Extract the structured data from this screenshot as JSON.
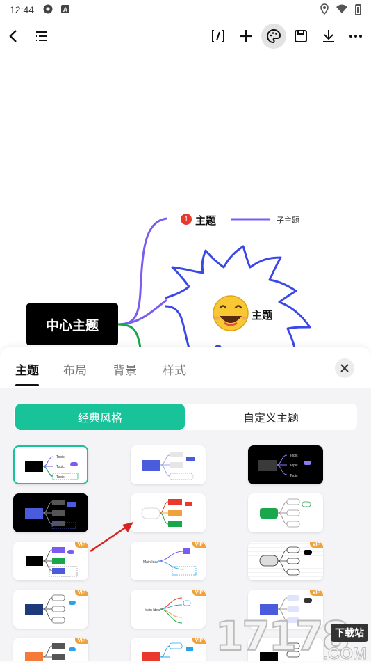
{
  "status_bar": {
    "time": "12:44",
    "icons": [
      "settings-icon",
      "app-a-icon",
      "location-icon",
      "wifi-icon",
      "battery-icon"
    ]
  },
  "toolbar": {
    "back": "back-arrow-icon",
    "outline": "outline-list-icon",
    "items": [
      "format-brush-icon",
      "add-icon",
      "palette-icon",
      "save-icon",
      "download-icon",
      "more-icon"
    ],
    "active_item": "palette-icon"
  },
  "mindmap": {
    "center": "中心主题",
    "topic1": "主题",
    "topic1_badge": "1",
    "subtopic": "子主题",
    "topic2": "主题"
  },
  "sheet": {
    "tabs": [
      "主题",
      "布局",
      "背景",
      "样式"
    ],
    "active_tab": "主题",
    "segments": {
      "classic": "经典风格",
      "custom": "自定义主题"
    },
    "thumb_text": {
      "topic": "Topic",
      "main_idea": "Main Idea"
    },
    "vip": "VIP"
  },
  "watermark": {
    "digits": "17178",
    "tag": "下载站",
    "domain": ".COM"
  },
  "colors": {
    "accent": "#19c39a",
    "vip": "#f0a23a",
    "arrow": "#d42424"
  }
}
